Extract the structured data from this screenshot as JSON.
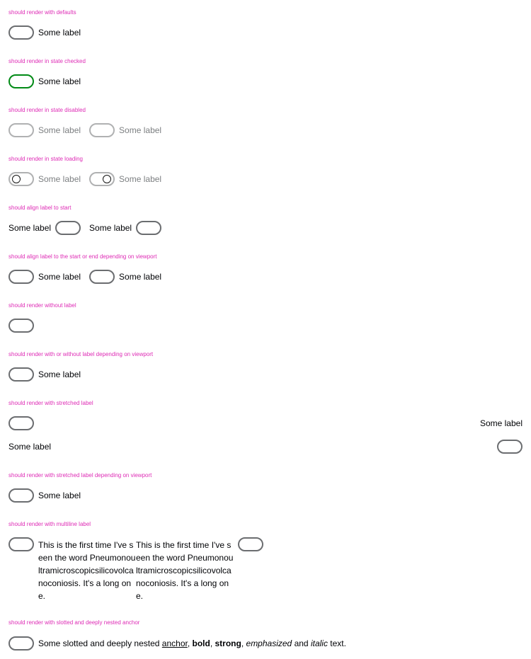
{
  "sections": [
    {
      "heading": "should render with defaults"
    },
    {
      "heading": "should render in state checked"
    },
    {
      "heading": "should render in state disabled"
    },
    {
      "heading": "should render in state loading"
    },
    {
      "heading": "should align label to start"
    },
    {
      "heading": "should align label to the start or end depending on viewport"
    },
    {
      "heading": "should render without label"
    },
    {
      "heading": "should render with or without label depending on viewport"
    },
    {
      "heading": "should render with stretched label"
    },
    {
      "heading": "should render with stretched label depending on viewport"
    },
    {
      "heading": "should render with multiline label"
    },
    {
      "heading": "should render with slotted and deeply nested anchor"
    }
  ],
  "label": "Some label",
  "multiline_label": "This is the first time I've seen the word Pneumonoultramicroscopicsilicovolcanoconiosis. It's a long one.",
  "rich": {
    "prefix": "Some slotted and deeply nested ",
    "anchor": "anchor",
    "comma1": ", ",
    "bold": "bold",
    "comma2": ", ",
    "strong": "strong",
    "comma3": ", ",
    "emphasized": "emphasized",
    "and": " and ",
    "italic": "italic",
    "suffix": " text."
  },
  "colors": {
    "heading": "#de2bb5",
    "checked": "#018a16",
    "border": "#6b6d70"
  }
}
